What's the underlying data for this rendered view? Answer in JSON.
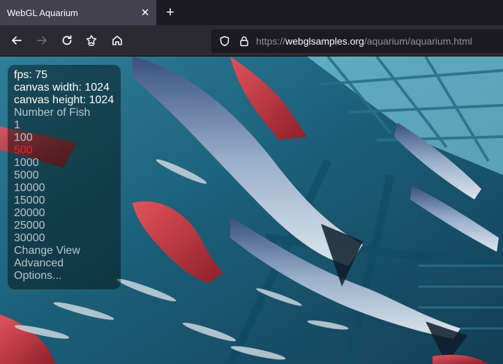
{
  "tab": {
    "title": "WebGL Aquarium"
  },
  "url": {
    "scheme": "https://",
    "host": "webglsamples.org",
    "path": "/aquarium/aquarium.html"
  },
  "overlay": {
    "fps": "fps: 75",
    "canvas_width": "canvas width: 1024",
    "canvas_height": "canvas height: 1024",
    "number_of_fish_label": "Number of Fish",
    "fish_options": [
      "1",
      "100",
      "500",
      "1000",
      "5000",
      "10000",
      "15000",
      "20000",
      "25000",
      "30000"
    ],
    "selected_option": "500",
    "change_view": "Change View",
    "advanced": "Advanced",
    "options": "Options..."
  },
  "colors": {
    "selected": "#ff1b1b",
    "water": "#1f5a73",
    "panel": "rgba(0,0,0,0.42)"
  }
}
